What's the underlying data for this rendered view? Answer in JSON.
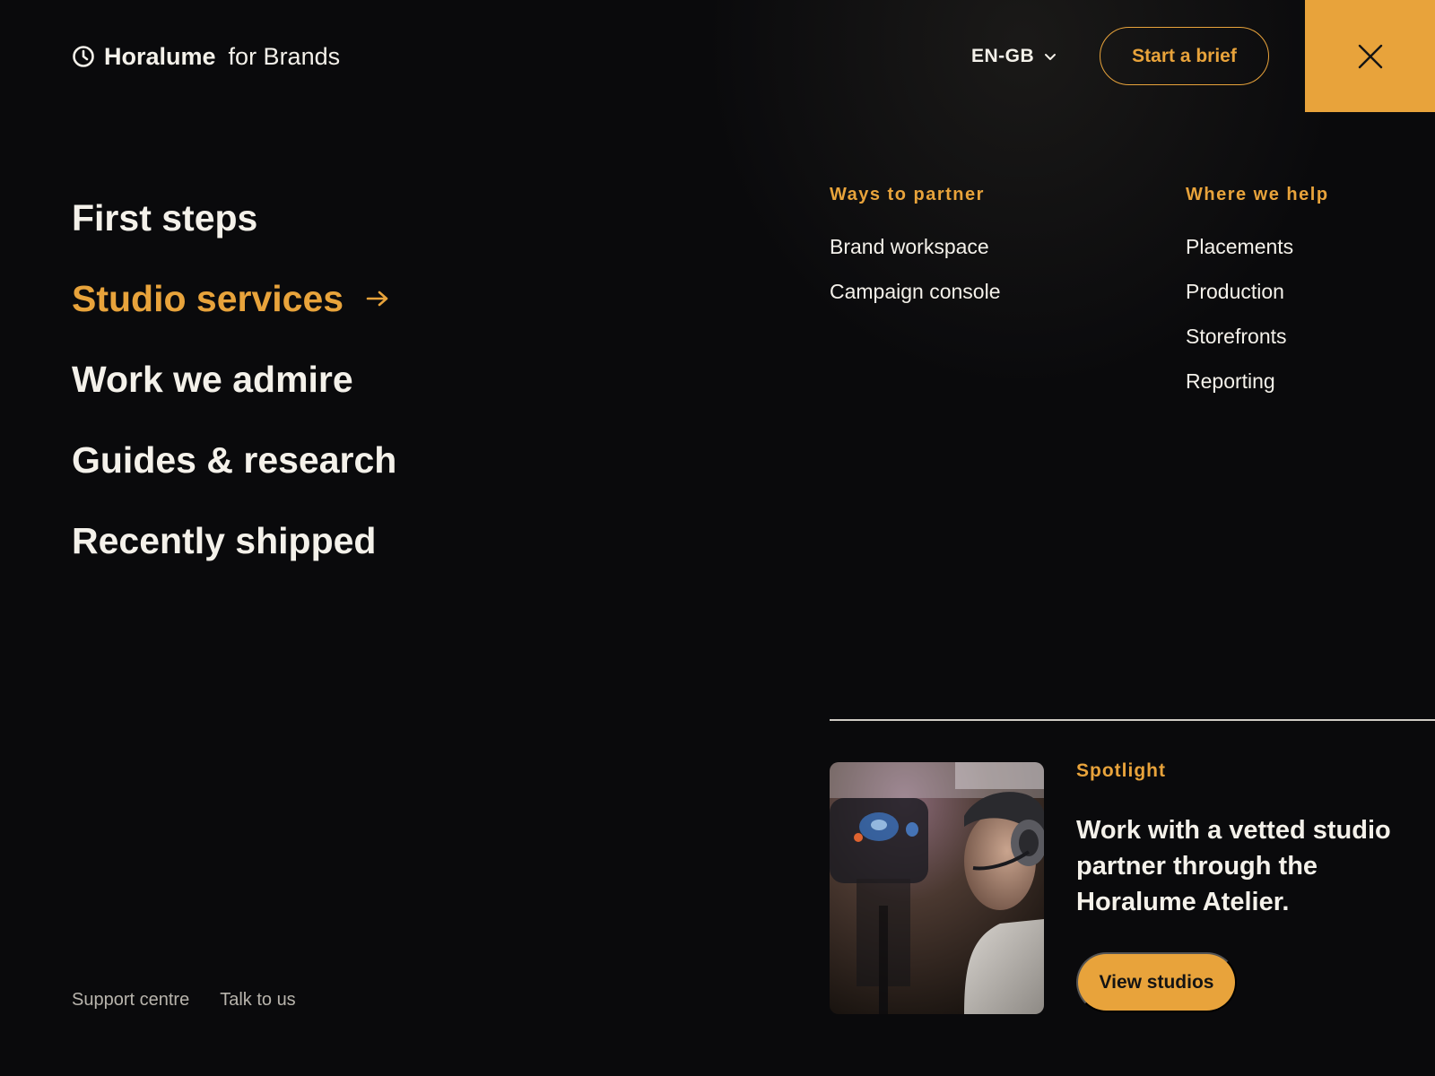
{
  "header": {
    "brand": "Horalume",
    "brand_suffix": "for Brands",
    "language": "EN-GB",
    "start_brief": "Start a brief"
  },
  "primary_nav": [
    {
      "label": "First steps",
      "active": false
    },
    {
      "label": "Studio services",
      "active": true
    },
    {
      "label": "Work we admire",
      "active": false
    },
    {
      "label": "Guides & research",
      "active": false
    },
    {
      "label": "Recently shipped",
      "active": false
    }
  ],
  "columns": {
    "ways_to_partner": {
      "heading": "Ways to partner",
      "items": [
        "Brand workspace",
        "Campaign console"
      ]
    },
    "where_we_help": {
      "heading": "Where we help",
      "items": [
        "Placements",
        "Production",
        "Storefronts",
        "Reporting"
      ]
    }
  },
  "spotlight": {
    "label": "Spotlight",
    "text": "Work with a vetted studio partner through the Horalume Atelier.",
    "button": "View studios"
  },
  "footer": {
    "links": [
      "Support centre",
      "Talk to us"
    ]
  },
  "colors": {
    "accent": "#e8a33b",
    "background": "#0a0a0c",
    "text": "#f4f1ea"
  },
  "icons": {
    "logo": "clock-icon",
    "language": "chevron-down-icon",
    "close": "close-icon",
    "active_nav": "arrow-right-icon"
  }
}
